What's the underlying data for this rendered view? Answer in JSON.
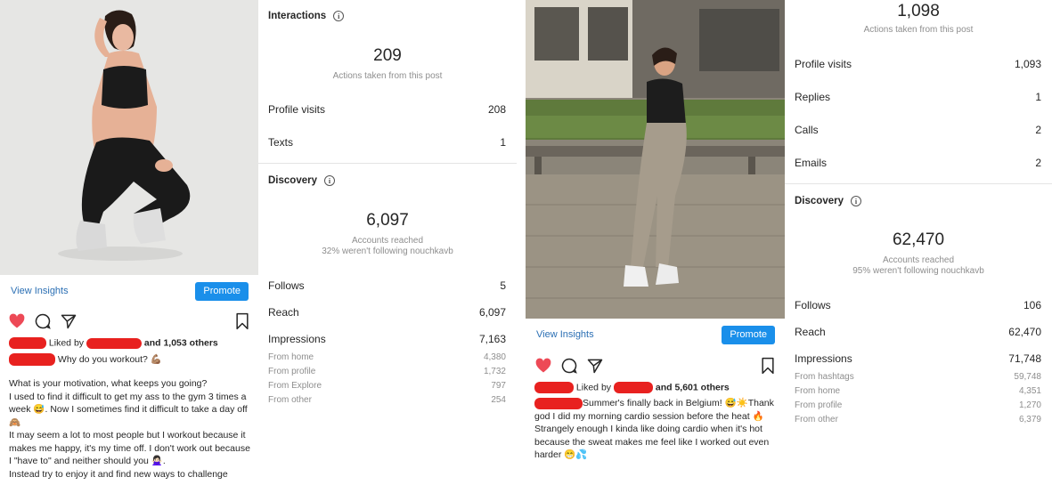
{
  "post1": {
    "view_insights": "View Insights",
    "promote": "Promote",
    "liked_by": "Liked by",
    "and_others": "and 1,053 others",
    "caption_first": "Why do you workout? 💪🏽",
    "caption_lines": [
      "What is your motivation, what keeps you going?",
      "I used to find it difficult to get my ass to the gym 3 times a week 😅. Now I sometimes find it difficult to take a day off 🙈",
      "It may seem a lot to most people but I workout because it makes me happy, it's my time off. I don't work out because I \"have to\" and neither should you 🙅🏻‍♀️.",
      "Instead try to enjoy it and find new ways to challenge"
    ],
    "icons": [
      "heart-icon",
      "comment-icon",
      "share-icon",
      "bookmark-icon"
    ],
    "colors": {
      "heart": "#ed4956",
      "promote": "#1a8fea",
      "redact": "#e8211f"
    }
  },
  "stats1": {
    "interactions_title": "Interactions",
    "interactions_total": "209",
    "interactions_sub": "Actions taken from this post",
    "interaction_rows": [
      {
        "label": "Profile visits",
        "value": "208"
      },
      {
        "label": "Texts",
        "value": "1"
      }
    ],
    "discovery_title": "Discovery",
    "accounts_reached": "6,097",
    "accounts_reached_label": "Accounts reached",
    "not_following": "32% weren't following nouchkavb",
    "discovery_rows": [
      {
        "label": "Follows",
        "value": "5"
      },
      {
        "label": "Reach",
        "value": "6,097"
      },
      {
        "label": "Impressions",
        "value": "7,163"
      }
    ],
    "impression_rows": [
      {
        "label": "From home",
        "value": "4,380"
      },
      {
        "label": "From profile",
        "value": "1,732"
      },
      {
        "label": "From Explore",
        "value": "797"
      },
      {
        "label": "From other",
        "value": "254"
      }
    ]
  },
  "post2": {
    "view_insights": "View Insights",
    "promote": "Promote",
    "liked_by": "Liked by",
    "and_others": "and 5,601 others",
    "caption_first": "Summer's finally back in Belgium! 😅☀️Thank god I did my morning cardio session before the heat 🔥",
    "caption_lines": [
      "Strangely enough I kinda like doing cardio when it's hot because the sweat makes me feel like I worked out even harder 😁💦"
    ]
  },
  "stats2": {
    "interactions_total": "1,098",
    "interactions_sub": "Actions taken from this post",
    "interaction_rows": [
      {
        "label": "Profile visits",
        "value": "1,093"
      },
      {
        "label": "Replies",
        "value": "1"
      },
      {
        "label": "Calls",
        "value": "2"
      },
      {
        "label": "Emails",
        "value": "2"
      }
    ],
    "discovery_title": "Discovery",
    "accounts_reached": "62,470",
    "accounts_reached_label": "Accounts reached",
    "not_following": "95% weren't following nouchkavb",
    "discovery_rows": [
      {
        "label": "Follows",
        "value": "106"
      },
      {
        "label": "Reach",
        "value": "62,470"
      },
      {
        "label": "Impressions",
        "value": "71,748"
      }
    ],
    "impression_rows": [
      {
        "label": "From hashtags",
        "value": "59,748"
      },
      {
        "label": "From home",
        "value": "4,351"
      },
      {
        "label": "From profile",
        "value": "1,270"
      },
      {
        "label": "From other",
        "value": "6,379"
      }
    ]
  }
}
